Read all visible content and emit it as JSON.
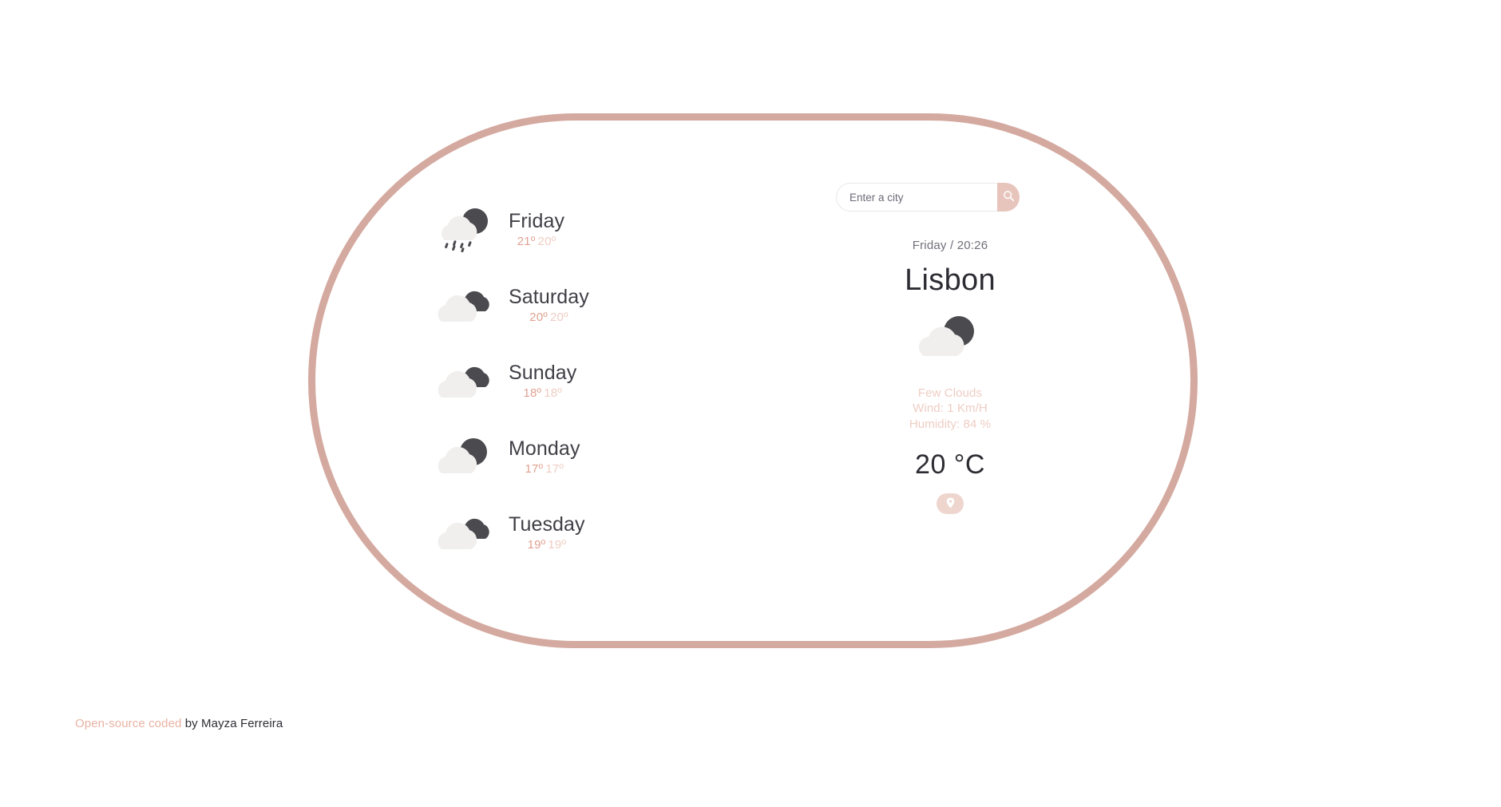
{
  "theme": {
    "accent": "#d4a99f",
    "accent_light": "#e7c5bc",
    "accent_pale": "#efcdc3",
    "text_dark": "#2c2c33",
    "text_muted": "#6f6f7a",
    "cloud_light": "#f0efee",
    "cloud_dark": "#4a4a4f"
  },
  "search": {
    "placeholder": "Enter a city",
    "value": "",
    "button_icon": "search-icon"
  },
  "current": {
    "datetime": "Friday / 20:26",
    "city": "Lisbon",
    "icon": "few-clouds-icon",
    "description": "Few Clouds",
    "wind": "Wind: 1 Km/H",
    "humidity": "Humidity: 84 %",
    "temperature": "20 °C",
    "geolocation_icon": "location-pin-icon"
  },
  "forecast": [
    {
      "day": "Friday",
      "icon": "shower-rain-icon",
      "temp_max": "21º",
      "temp_min": "20º"
    },
    {
      "day": "Saturday",
      "icon": "broken-clouds-icon",
      "temp_max": "20º",
      "temp_min": "20º"
    },
    {
      "day": "Sunday",
      "icon": "broken-clouds-icon",
      "temp_max": "18º",
      "temp_min": "18º"
    },
    {
      "day": "Monday",
      "icon": "few-clouds-icon",
      "temp_max": "17º",
      "temp_min": "17º"
    },
    {
      "day": "Tuesday",
      "icon": "broken-clouds-icon",
      "temp_max": "19º",
      "temp_min": "19º"
    }
  ],
  "footer": {
    "link_text": "Open-source coded",
    "author_text": " by Mayza Ferreira"
  }
}
